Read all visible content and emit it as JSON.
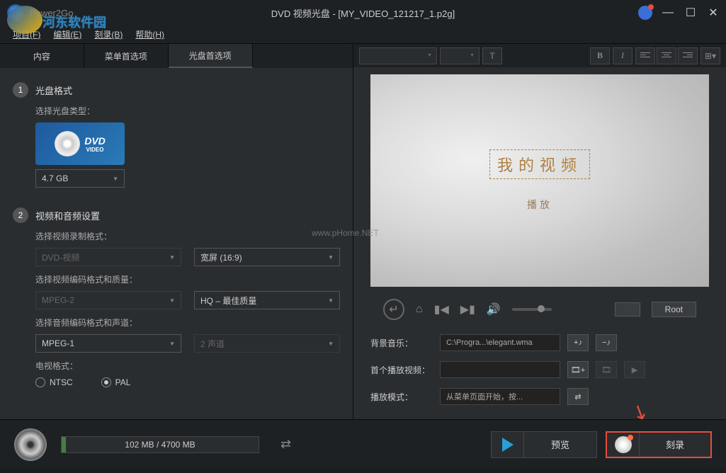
{
  "app_name": "Power2Go",
  "window_title": "DVD 视频光盘 - [MY_VIDEO_121217_1.p2g]",
  "watermark": {
    "site": "河东软件园",
    "center": "www.pHome.NET"
  },
  "menubar": [
    {
      "label": "项目",
      "key": "(F)"
    },
    {
      "label": "编辑",
      "key": "(E)"
    },
    {
      "label": "刻录",
      "key": "(B)"
    },
    {
      "label": "帮助",
      "key": "(H)"
    }
  ],
  "tabs": {
    "content": "内容",
    "menu_pref": "菜单首选项",
    "disc_pref": "光盘首选项"
  },
  "step1": {
    "num": "1",
    "title": "光盘格式",
    "sub": "选择光盘类型：",
    "dvd_label": "DVD",
    "dvd_sub": "VIDEO",
    "size": "4.7 GB"
  },
  "step2": {
    "num": "2",
    "title": "视频和音频设置",
    "sub_format": "选择视频录制格式：",
    "video_format": "DVD-视频",
    "aspect": "宽屏 (16:9)",
    "sub_encode": "选择视频编码格式和质量：",
    "vcodec": "MPEG-2",
    "vquality": "HQ – 最佳质量",
    "sub_audio": "选择音频编码格式和声道：",
    "acodec": "MPEG-1",
    "channels": "2 声道",
    "tv_label": "电视格式：",
    "ntsc": "NTSC",
    "pal": "PAL"
  },
  "toolbar": {
    "bold": "B",
    "italic": "I"
  },
  "preview": {
    "title": "我的视频",
    "play": "播放"
  },
  "player": {
    "root": "Root"
  },
  "props": {
    "bgm_label": "背景音乐：",
    "bgm_value": "C:\\Progra...\\elegant.wma",
    "add_note": "+♪",
    "del_note": "−♪",
    "firstplay_label": "首个播放视频：",
    "playmode_label": "播放模式：",
    "playmode_value": "从菜单页面开始，按..."
  },
  "bottom": {
    "size": "102 MB / 4700 MB",
    "preview": "预览",
    "burn": "刻录"
  }
}
